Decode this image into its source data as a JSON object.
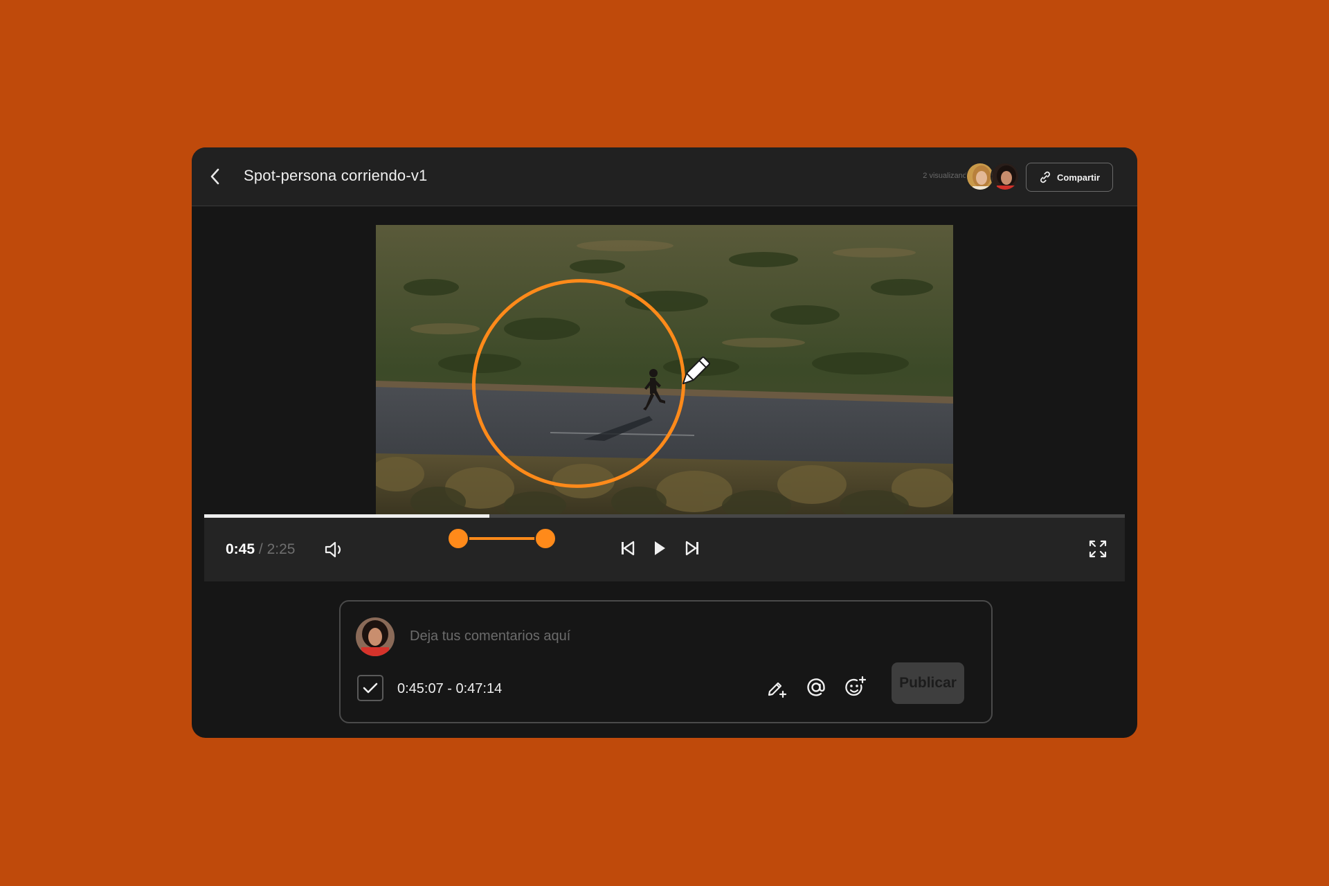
{
  "header": {
    "title": "Spot-persona corriendo-v1",
    "viewers_label": "2 visualizando",
    "share_label": "Compartir",
    "back_icon": "chevron-left-icon",
    "share_icon": "link-icon"
  },
  "player": {
    "current_time": "0:45",
    "separator": "/",
    "duration": "2:25",
    "progress": 0.31,
    "selection": {
      "start": "0:45",
      "end": "0:47"
    },
    "annotation_color": "#ff8a1a",
    "icons": [
      "volume-icon",
      "previous-frame-icon",
      "play-icon",
      "next-frame-icon",
      "fullscreen-icon",
      "pencil-icon"
    ]
  },
  "comment": {
    "placeholder": "Deja tus comentarios aquí",
    "range_checked": true,
    "range_label": "0:45:07 - 0:47:14",
    "publish_label": "Publicar",
    "tool_icons": [
      "pencil-plus-icon",
      "at-mention-icon",
      "emoji-add-icon"
    ]
  },
  "colors": {
    "background": "#bf4a0b",
    "window": "#161616",
    "titlebar": "#212121",
    "accent": "#ff8a1a"
  }
}
